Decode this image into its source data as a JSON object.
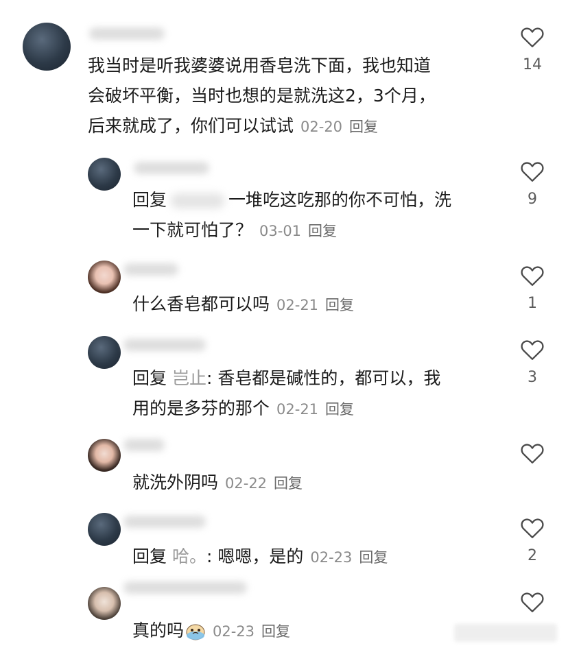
{
  "comments": [
    {
      "text_lines": [
        "我当时是听我婆婆说用香皂洗下面，我也知道",
        "会破坏平衡，当时也想的是就洗这2，3个月，",
        "后来就成了，你们可以试试"
      ],
      "date": "02-20",
      "reply_label": "回复",
      "likes": "14"
    },
    {
      "prefix": "回复",
      "text_lines": [
        "一堆吃这吃那的你不可怕，洗",
        "一下就可怕了？"
      ],
      "date": "03-01",
      "reply_label": "回复",
      "likes": "9"
    },
    {
      "text_lines": [
        "什么香皂都可以吗"
      ],
      "date": "02-21",
      "reply_label": "回复",
      "likes": "1"
    },
    {
      "prefix": "回复",
      "mention": "岂止",
      "text_lines": [
        ": 香皂都是碱性的，都可以，我",
        "用的是多芬的那个"
      ],
      "date": "02-21",
      "reply_label": "回复",
      "likes": "3"
    },
    {
      "text_lines": [
        "就洗外阴吗"
      ],
      "date": "02-22",
      "reply_label": "回复",
      "likes": ""
    },
    {
      "prefix": "回复",
      "mention": "哈。",
      "text_lines": [
        ": 嗯嗯，是的"
      ],
      "date": "02-23",
      "reply_label": "回复",
      "likes": "2"
    },
    {
      "text_lines": [
        "真的吗"
      ],
      "emoji": "crying-face-emoji",
      "date": "02-23",
      "reply_label": "回复",
      "likes": ""
    }
  ],
  "colors": {
    "text": "#1b1b1b",
    "date": "#8a8a8a",
    "mention": "#9a9a9a",
    "icon": "#4a4a4a"
  }
}
